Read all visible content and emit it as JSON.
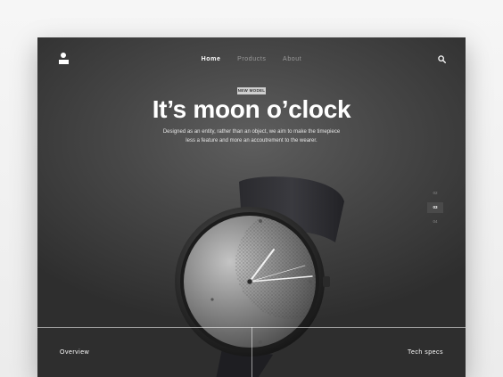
{
  "nav": {
    "items": [
      "Home",
      "Products",
      "About"
    ],
    "active": "Home"
  },
  "icons": {
    "logo": "brand-logo-icon",
    "search": "search-icon"
  },
  "hero": {
    "badge": "NEW MODEL",
    "title": "It’s moon o’clock",
    "subtitle_line1": "Designed as an entity, rather than an object, we aim to make the timepiece",
    "subtitle_line2": "less a feature and more an accoutrement to the wearer."
  },
  "pager": {
    "prev": "02",
    "current": "03",
    "next": "04"
  },
  "footer": {
    "left": "Overview",
    "right": "Tech specs"
  },
  "colors": {
    "background": "#4a4a4a",
    "text": "#ffffff",
    "badge": "#cfcfcf"
  }
}
